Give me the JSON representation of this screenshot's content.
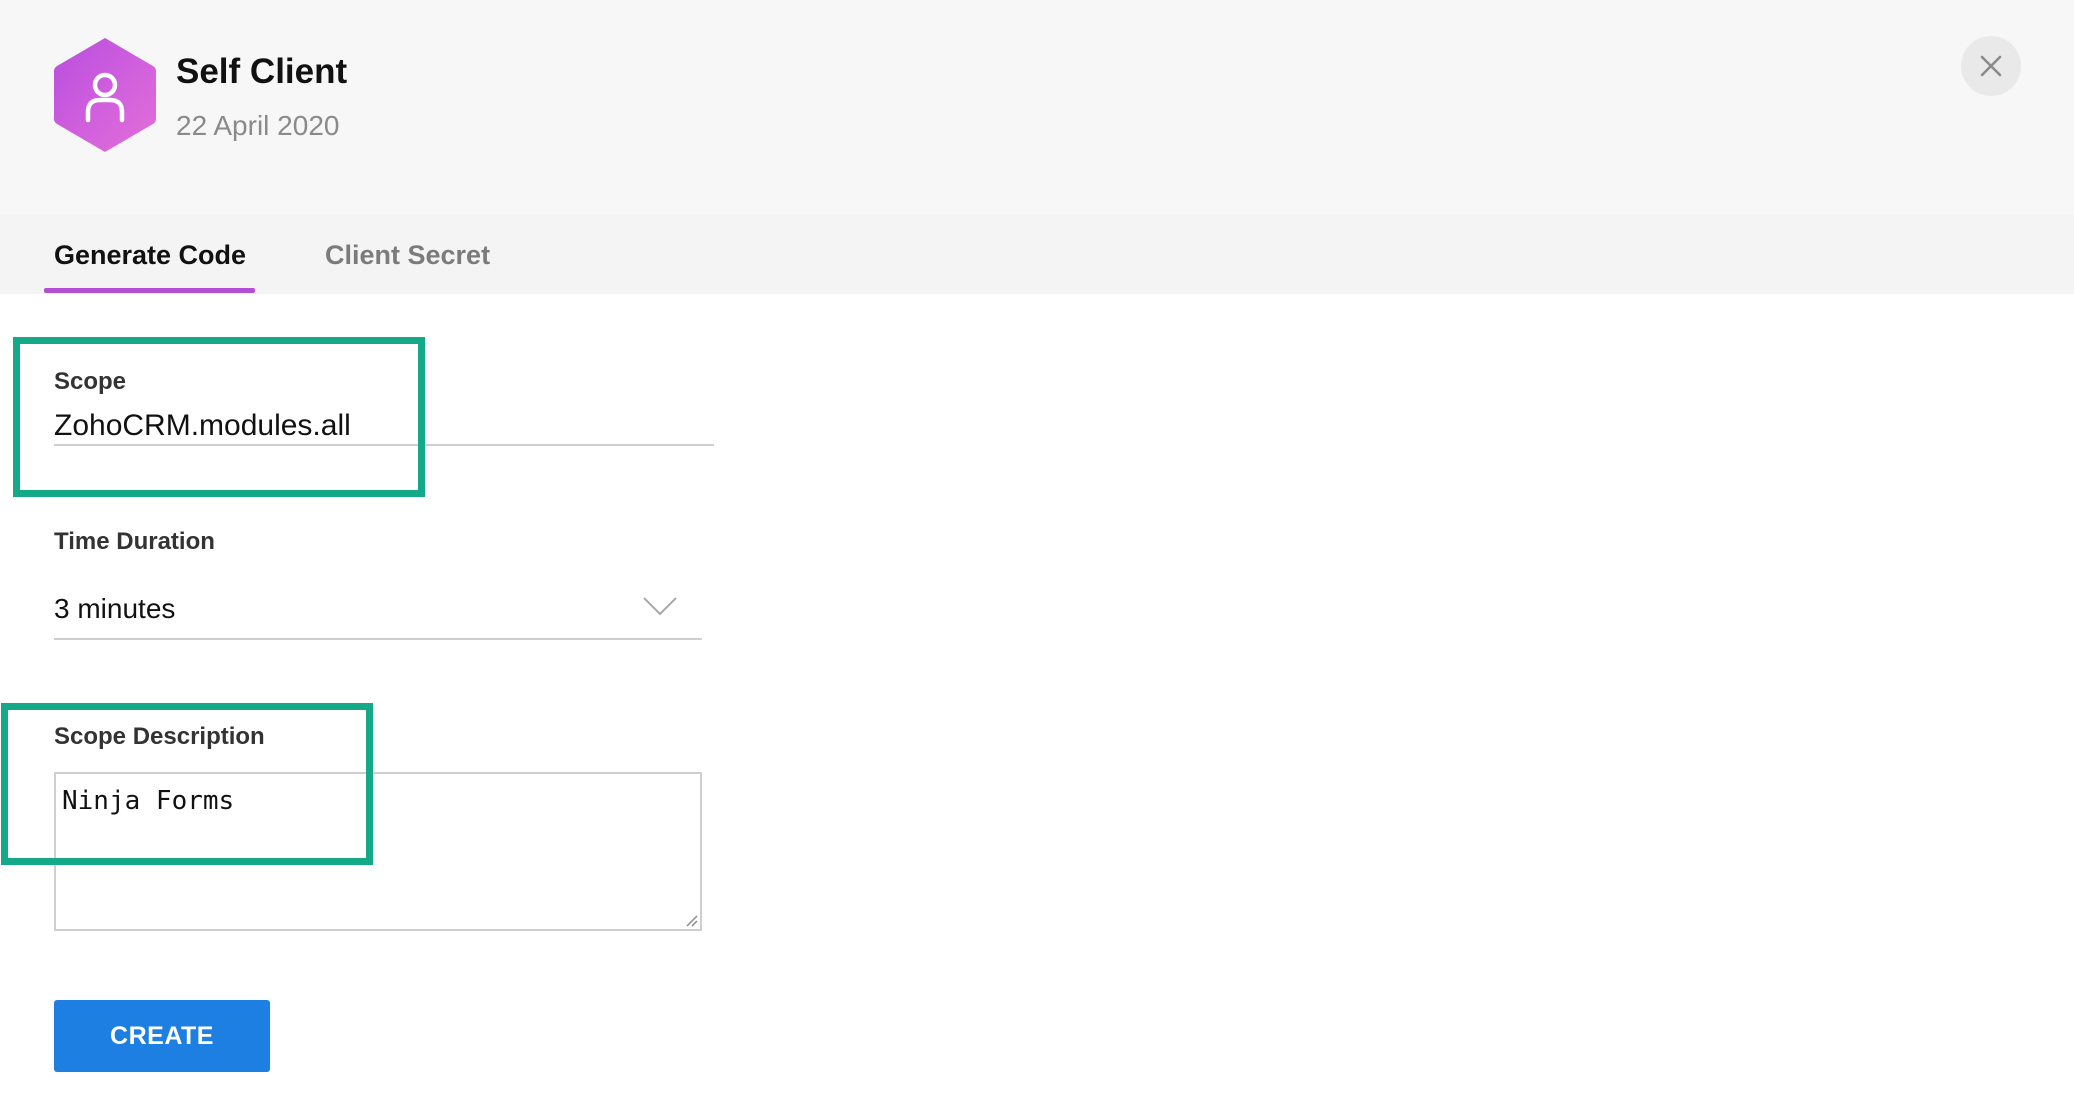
{
  "header": {
    "title": "Self Client",
    "date": "22 April 2020",
    "icon": "user-icon",
    "icon_gradient": [
      "#b94ee0",
      "#e46fd9"
    ],
    "close_icon": "close-icon"
  },
  "tabs": [
    {
      "label": "Generate Code",
      "active": true
    },
    {
      "label": "Client Secret",
      "active": false
    }
  ],
  "form": {
    "scope": {
      "label": "Scope",
      "value": "ZohoCRM.modules.all"
    },
    "time_duration": {
      "label": "Time Duration",
      "value": "3 minutes"
    },
    "scope_description": {
      "label": "Scope Description",
      "value": "Ninja Forms"
    },
    "create_label": "CREATE"
  },
  "colors": {
    "accent": "#b24fd6",
    "button": "#1d7fe1",
    "highlight": "#14a989"
  }
}
